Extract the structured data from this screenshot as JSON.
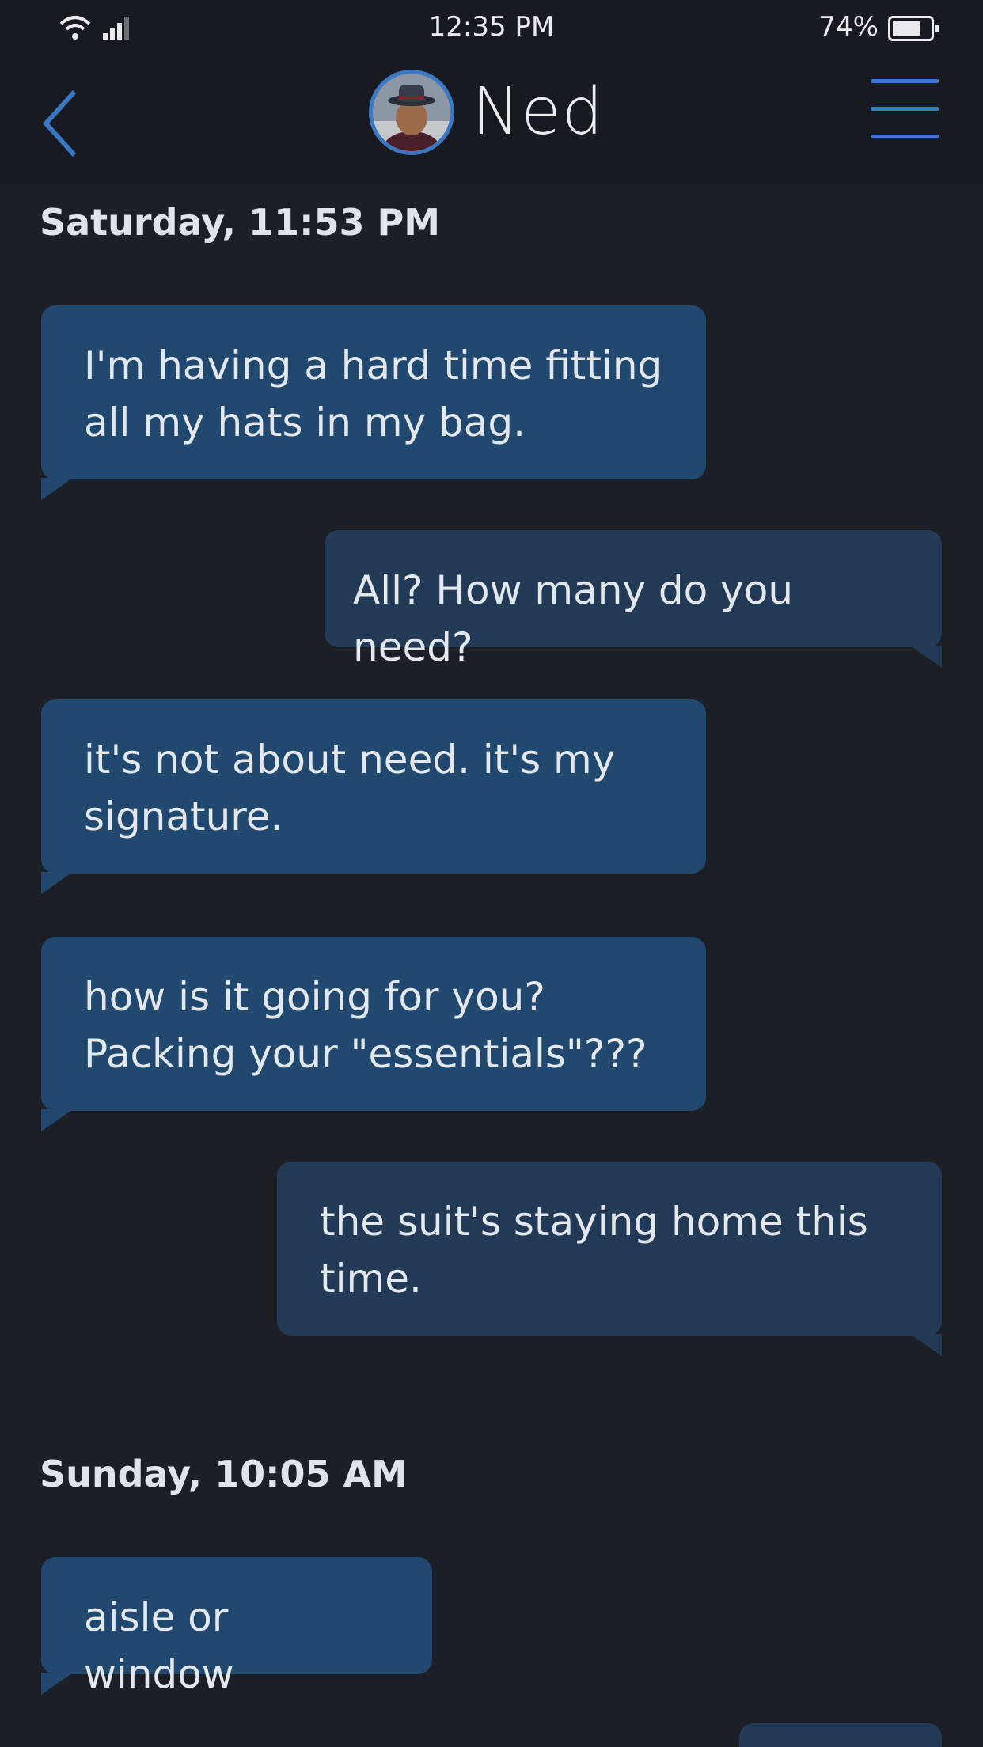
{
  "status_bar": {
    "time": "12:35 PM",
    "battery_percent": "74%",
    "battery_level": 0.74,
    "icons": [
      "wifi-icon",
      "signal-icon",
      "battery-icon"
    ]
  },
  "header": {
    "contact_name": "Ned",
    "back_icon": "chevron-left-icon",
    "menu_icon": "hamburger-menu-icon"
  },
  "colors": {
    "accent": "#3a78c4",
    "incoming_bubble": "#21496f",
    "outgoing_bubble": "#233a57",
    "background": "#1d1f27"
  },
  "thread": {
    "groups": [
      {
        "date": "Saturday, 11:53 PM",
        "messages": [
          {
            "direction": "incoming",
            "line1": "I'm having a hard time fitting",
            "line2": "all my hats in my bag."
          },
          {
            "direction": "outgoing",
            "line1": "All? How many do you need?"
          },
          {
            "direction": "incoming",
            "line1": "it's not about need. it's my",
            "line2": "signature."
          },
          {
            "direction": "incoming",
            "line1": "how is it going for you?",
            "line2": "Packing your \"essentials\"???"
          },
          {
            "direction": "outgoing",
            "line1": "the suit's staying home this",
            "line2": "time."
          }
        ]
      },
      {
        "date": "Sunday, 10:05 AM",
        "messages": [
          {
            "direction": "incoming",
            "line1": "aisle or window"
          }
        ]
      }
    ]
  }
}
